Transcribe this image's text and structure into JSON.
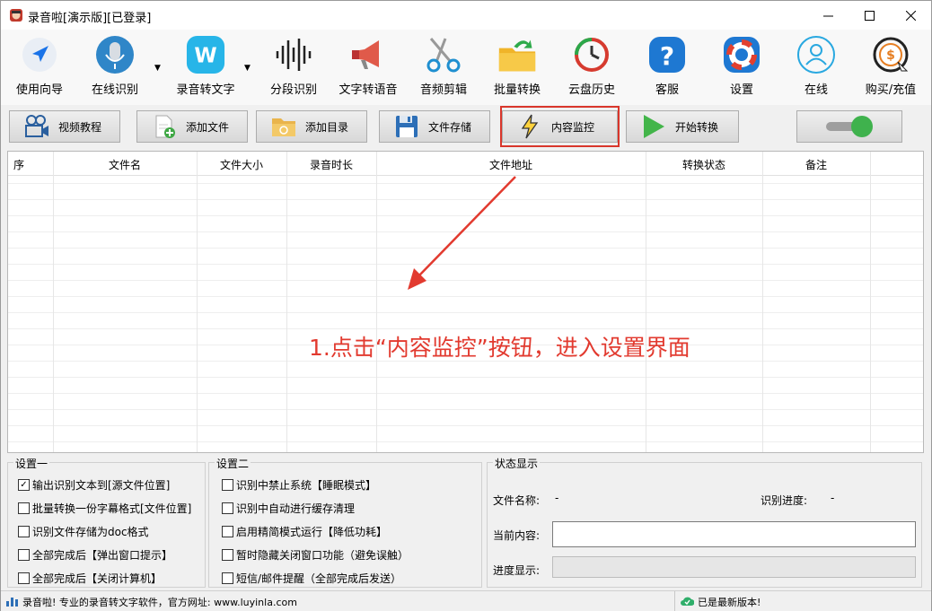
{
  "window": {
    "title": "录音啦[演示版][已登录]"
  },
  "toolbar": {
    "items": [
      {
        "label": "使用向导",
        "icon": "navigation-arrow-icon"
      },
      {
        "label": "在线识别",
        "icon": "microphone-icon"
      },
      {
        "label": "录音转文字",
        "icon": "w-logo-icon"
      },
      {
        "label": "分段识别",
        "icon": "waveform-icon"
      },
      {
        "label": "文字转语音",
        "icon": "megaphone-icon"
      },
      {
        "label": "音频剪辑",
        "icon": "scissors-icon"
      },
      {
        "label": "批量转换",
        "icon": "folder-arrow-icon"
      },
      {
        "label": "云盘历史",
        "icon": "history-clock-icon"
      },
      {
        "label": "客服",
        "icon": "help-question-icon"
      },
      {
        "label": "设置",
        "icon": "lifebuoy-icon"
      },
      {
        "label": "在线",
        "icon": "user-icon"
      },
      {
        "label": "购买/充值",
        "icon": "dollar-coin-icon"
      }
    ]
  },
  "actions": {
    "video_tutorial": "视频教程",
    "add_file": "添加文件",
    "add_folder": "添加目录",
    "file_storage": "文件存储",
    "content_monitor": "内容监控",
    "start_convert": "开始转换"
  },
  "table": {
    "columns": [
      "序",
      "文件名",
      "文件大小",
      "录音时长",
      "文件地址",
      "转换状态",
      "备注"
    ],
    "rows": []
  },
  "annotation": "1.点击“内容监控”按钮，进入设置界面",
  "settings1": {
    "title": "设置一",
    "options": [
      {
        "label": "输出识别文本到[源文件位置]",
        "checked": true
      },
      {
        "label": "批量转换一份字幕格式[文件位置]",
        "checked": false
      },
      {
        "label": "识别文件存储为doc格式",
        "checked": false
      },
      {
        "label": "全部完成后【弹出窗口提示】",
        "checked": false
      },
      {
        "label": "全部完成后【关闭计算机】",
        "checked": false
      }
    ]
  },
  "settings2": {
    "title": "设置二",
    "options": [
      {
        "label": "识别中禁止系统【睡眠模式】",
        "checked": false
      },
      {
        "label": "识别中自动进行缓存清理",
        "checked": false
      },
      {
        "label": "启用精简模式运行【降低功耗】",
        "checked": false
      },
      {
        "label": "暂时隐藏关闭窗口功能（避免误触）",
        "checked": false
      },
      {
        "label": "短信/邮件提醒（全部完成后发送）",
        "checked": false
      }
    ]
  },
  "status": {
    "title": "状态显示",
    "file_name_label": "文件名称:",
    "file_name_value": "-",
    "progress_label": "识别进度:",
    "progress_value": "-",
    "current_content_label": "当前内容:",
    "current_content_value": "",
    "progress_display_label": "进度显示:",
    "progress_display_value": 0
  },
  "statusbar": {
    "left": "录音啦! 专业的录音转文字软件，官方网址: www.luyinla.com",
    "right": "已是最新版本!"
  },
  "colors": {
    "highlight": "#d9362b",
    "toggle_on": "#3fb24d",
    "annotation": "#e23a2f"
  }
}
